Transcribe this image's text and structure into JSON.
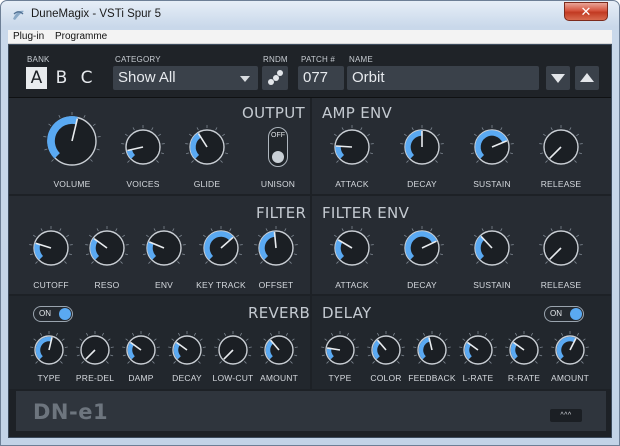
{
  "window": {
    "title": "DuneMagix - VSTi Spur 5",
    "close_symbol": "✕"
  },
  "menu": [
    "Plug-in",
    "Programme"
  ],
  "topbar": {
    "bank_label": "BANK",
    "banks": [
      "A",
      "B",
      "C"
    ],
    "bank_selected": "A",
    "category_label": "CATEGORY",
    "category_value": "Show All",
    "random_label": "RNDM",
    "patch_label": "PATCH #",
    "patch_value": "077",
    "name_label": "NAME",
    "name_value": "Orbit"
  },
  "sections": {
    "output": {
      "title": "OUTPUT",
      "knobs": [
        {
          "label": "VOLUME",
          "value": 0.55
        },
        {
          "label": "VOICES",
          "value": 0.12
        },
        {
          "label": "GLIDE",
          "value": 0.38
        }
      ],
      "unison": {
        "label": "UNISON",
        "state": "OFF"
      }
    },
    "amp_env": {
      "title": "AMP ENV",
      "knobs": [
        {
          "label": "ATTACK",
          "value": 0.18
        },
        {
          "label": "DECAY",
          "value": 0.5
        },
        {
          "label": "SUSTAIN",
          "value": 0.75
        },
        {
          "label": "RELEASE",
          "value": 0.0
        }
      ]
    },
    "filter": {
      "title": "FILTER",
      "knobs": [
        {
          "label": "CUTOFF",
          "value": 0.23
        },
        {
          "label": "RESO",
          "value": 0.3
        },
        {
          "label": "ENV",
          "value": 0.25
        },
        {
          "label": "KEY TRACK",
          "value": 0.68
        },
        {
          "label": "OFFSET",
          "value": 0.48
        }
      ]
    },
    "filter_env": {
      "title": "FILTER ENV",
      "knobs": [
        {
          "label": "ATTACK",
          "value": 0.28
        },
        {
          "label": "DECAY",
          "value": 0.74
        },
        {
          "label": "SUSTAIN",
          "value": 0.34
        },
        {
          "label": "RELEASE",
          "value": 0.0
        }
      ]
    },
    "reverb": {
      "title": "REVERB",
      "toggle": "ON",
      "knobs": [
        {
          "label": "TYPE",
          "value": 0.55
        },
        {
          "label": "PRE-DEL",
          "value": 0.0
        },
        {
          "label": "DAMP",
          "value": 0.3
        },
        {
          "label": "DECAY",
          "value": 0.3
        },
        {
          "label": "LOW-CUT",
          "value": 0.0
        },
        {
          "label": "AMOUNT",
          "value": 0.35
        }
      ]
    },
    "delay": {
      "title": "DELAY",
      "toggle": "ON",
      "knobs": [
        {
          "label": "TYPE",
          "value": 0.2
        },
        {
          "label": "COLOR",
          "value": 0.35
        },
        {
          "label": "FEEDBACK",
          "value": 0.45
        },
        {
          "label": "L-RATE",
          "value": 0.3
        },
        {
          "label": "R-RATE",
          "value": 0.3
        },
        {
          "label": "AMOUNT",
          "value": 0.6
        }
      ]
    }
  },
  "footer": {
    "logo": "DN-e1",
    "expand_label": "^^^"
  },
  "colors": {
    "accent": "#5aa9f2",
    "panel": "#272c33",
    "background": "#1d2126"
  }
}
